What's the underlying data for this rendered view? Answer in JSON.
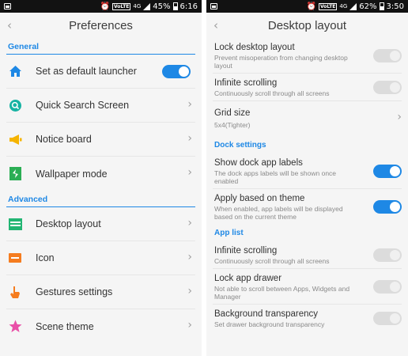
{
  "left": {
    "status": {
      "volte": "VoLTE",
      "net": "4G",
      "battery": "45%",
      "time": "6:16"
    },
    "title": "Preferences",
    "sections": {
      "general": "General",
      "advanced": "Advanced"
    },
    "items": {
      "launcher": "Set as default launcher",
      "quick_search": "Quick Search Screen",
      "notice": "Notice board",
      "wallpaper": "Wallpaper mode",
      "desktop_layout": "Desktop layout",
      "icon": "Icon",
      "gestures": "Gestures settings",
      "scene": "Scene theme"
    }
  },
  "right": {
    "status": {
      "volte": "VoLTE",
      "net": "4G",
      "battery": "62%",
      "time": "3:50"
    },
    "title": "Desktop layout",
    "sections": {
      "dock": "Dock settings",
      "applist": "App list"
    },
    "items": {
      "lock_title": "Lock desktop layout",
      "lock_sub": "Prevent misoperation from changing desktop layout",
      "inf1_title": "Infinite scrolling",
      "inf1_sub": "Continuously scroll through all screens",
      "grid_title": "Grid size",
      "grid_sub": "5x4(Tighter)",
      "dock_labels_title": "Show dock app labels",
      "dock_labels_sub": "The dock apps labels will be shown once enabled",
      "theme_title": "Apply based on theme",
      "theme_sub": "When enabled, app labels will be displayed based on the current theme",
      "inf2_title": "Infinite scrolling",
      "inf2_sub": "Continuously scroll through all screens",
      "lockdrawer_title": "Lock app drawer",
      "lockdrawer_sub": "Not able to scroll between Apps, Widgets and Manager",
      "bg_title": "Background transparency",
      "bg_sub": "Set drawer background transparency"
    }
  },
  "colors": {
    "accent": "#1e88e5",
    "toggle_off": "#dcdcdc"
  }
}
